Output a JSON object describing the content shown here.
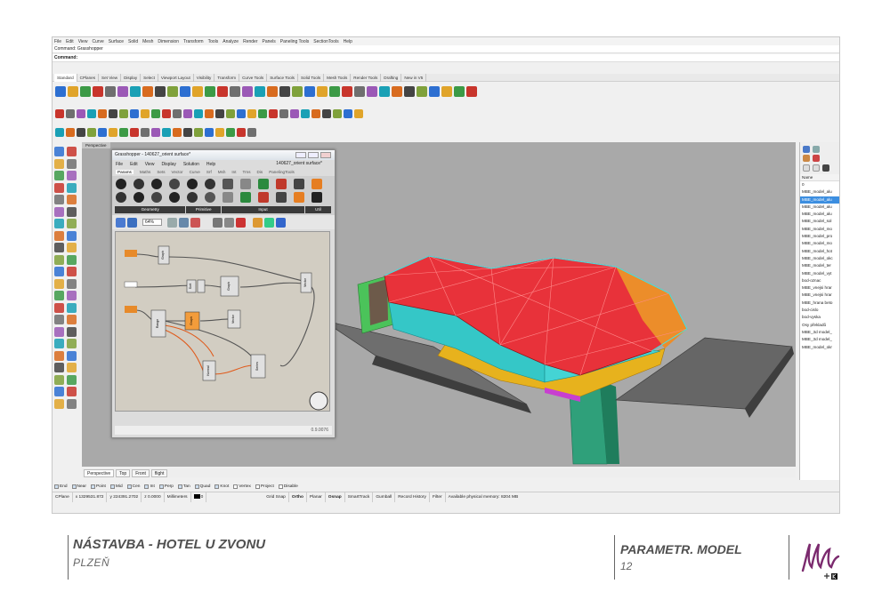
{
  "menubar": {
    "items": [
      "File",
      "Edit",
      "View",
      "Curve",
      "Surface",
      "Solid",
      "Mesh",
      "Dimension",
      "Transform",
      "Tools",
      "Analyze",
      "Render",
      "Panels",
      "Paneling Tools",
      "SectionTools",
      "Help"
    ]
  },
  "command": {
    "history": "Command: Grasshopper",
    "prompt": "Command:"
  },
  "toolbar_tabs": [
    "Standard",
    "CPlanes",
    "Set View",
    "Display",
    "Select",
    "Viewport Layout",
    "Visibility",
    "Transform",
    "Curve Tools",
    "Surface Tools",
    "Solid Tools",
    "Mesh Tools",
    "Render Tools",
    "Drafting",
    "New in V5"
  ],
  "viewport": {
    "label": "Perspective"
  },
  "grasshopper": {
    "title": "Grasshopper - 140627_orient surface*",
    "document": "140627_orient surface*",
    "menu": [
      "File",
      "Edit",
      "View",
      "Display",
      "Solution",
      "Help"
    ],
    "tabs": [
      "Params",
      "Maths",
      "Sets",
      "Vector",
      "Curve",
      "Srf",
      "Msh",
      "Int",
      "Trns",
      "Dis",
      "PanelingTools"
    ],
    "groups": [
      "Geometry",
      "Primitive",
      "Input",
      "Util"
    ],
    "zoom": "64%",
    "status": "0.9.0076",
    "components": [
      "Graph",
      "Sort",
      "Graph",
      "Vector",
      "Range",
      "Graph",
      "Vector",
      "Normal",
      "Series",
      "Graph"
    ]
  },
  "layers": {
    "header": "Name",
    "items": [
      "0",
      "MBE_model_alu",
      "MBE_model_alu",
      "MBE_model_alu",
      "MBE_model_alu",
      "MBE_model_sol",
      "MBE_model_mo",
      "MBE_model_pro",
      "MBE_model_mo",
      "MBE_model_hot",
      "MBE_model_okc",
      "MBE_model_ter",
      "MBE_model_vyt",
      "bod-oznac",
      "MBE_vnejsi hrar",
      "MBE_vnejsi hrar",
      "MBE_hrana beto",
      "bod-cislo",
      "bod-vyska",
      "Osy překladů",
      "MBE_3d model_",
      "MBE_3d model_",
      "MBE_model_okr"
    ],
    "selected_index": 2
  },
  "view_tabs": [
    "Perspective",
    "Top",
    "Front",
    "flight"
  ],
  "osnap": [
    {
      "label": "End",
      "on": true
    },
    {
      "label": "Near",
      "on": true
    },
    {
      "label": "Point",
      "on": true
    },
    {
      "label": "Mid",
      "on": true
    },
    {
      "label": "Cen",
      "on": true
    },
    {
      "label": "Int",
      "on": true
    },
    {
      "label": "Perp",
      "on": true
    },
    {
      "label": "Tan",
      "on": true
    },
    {
      "label": "Quad",
      "on": true
    },
    {
      "label": "Knot",
      "on": true
    },
    {
      "label": "Vertex",
      "on": false
    },
    {
      "label": "Project",
      "on": false
    },
    {
      "label": "Disable",
      "on": false
    }
  ],
  "status": {
    "cplane": "CPlane",
    "x": "x 1329531.872",
    "y": "y 224391.2702",
    "z": "z 0.0000",
    "units": "Millimeters",
    "layer": "0",
    "grid_snap": "Grid Snap",
    "ortho": "Ortho",
    "planar": "Planar",
    "osnap": "Osnap",
    "smarttrack": "SmartTrack",
    "gumball": "Gumball",
    "record_history": "Record History",
    "filter": "Filter",
    "memory": "Available physical memory: 8204 MB"
  },
  "footer": {
    "project": "NÁSTAVBA - HOTEL U ZVONU",
    "city": "PLZEŇ",
    "section": "PARAMETR. MODEL",
    "page": "12"
  },
  "colors": {
    "roof_red": "#e8323a",
    "glass_cyan": "#35c7c7",
    "steel_yellow": "#e7b21d",
    "column_green": "#2fa07a",
    "accent_blue": "#3c8ee0"
  }
}
